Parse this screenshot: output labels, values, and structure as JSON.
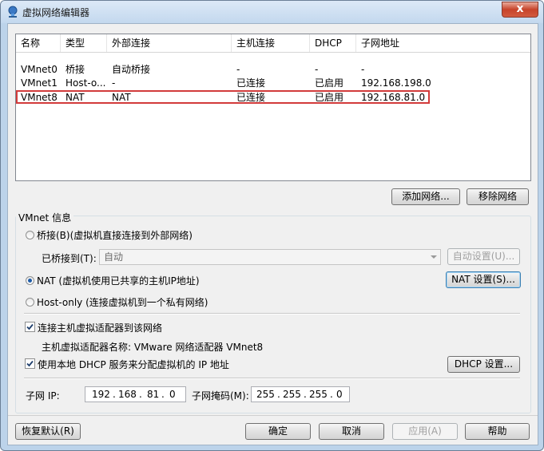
{
  "window": {
    "title": "虚拟网络编辑器",
    "close_glyph": "x"
  },
  "columns": [
    "名称",
    "类型",
    "外部连接",
    "主机连接",
    "DHCP",
    "子网地址"
  ],
  "rows": [
    [
      "VMnet0",
      "桥接",
      "自动桥接",
      "-",
      "-",
      "-"
    ],
    [
      "VMnet1",
      "Host-o...",
      "-",
      "已连接",
      "已启用",
      "192.168.198.0"
    ],
    [
      "VMnet8",
      "NAT",
      "NAT",
      "已连接",
      "已启用",
      "192.168.81.0"
    ]
  ],
  "list_buttons": {
    "add": "添加网络...",
    "remove": "移除网络"
  },
  "vmnet_info": {
    "group_label": "VMnet 信息",
    "bridged_label": "桥接(B)(虚拟机直接连接到外部网络)",
    "bridged_to_label": "已桥接到(T):",
    "bridged_to_value": "自动",
    "auto_settings": "自动设置(U)...",
    "nat_label": "NAT (虚拟机使用已共享的主机IP地址)",
    "nat_settings": "NAT 设置(S)...",
    "hostonly_label": "Host-only (连接虚拟机到一个私有网络)",
    "connect_adapter_label": "连接主机虚拟适配器到该网络",
    "adapter_name_text": "主机虚拟适配器名称: VMware 网络适配器 VMnet8",
    "dhcp_label": "使用本地 DHCP 服务来分配虚拟机的 IP 地址",
    "dhcp_settings": "DHCP 设置...",
    "subnet_ip_label": "子网 IP:",
    "subnet_ip": [
      "192",
      "168",
      "81",
      "0"
    ],
    "subnet_mask_label": "子网掩码(M):",
    "subnet_mask": [
      "255",
      "255",
      "255",
      "0"
    ]
  },
  "footer": {
    "restore": "恢复默认(R)",
    "ok": "确定",
    "cancel": "取消",
    "apply": "应用(A)",
    "help": "帮助"
  },
  "selected_mode": "NAT",
  "highlight_color": "#d23b3b"
}
